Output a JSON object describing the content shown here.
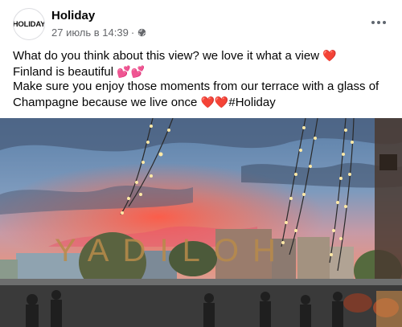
{
  "post": {
    "page_name": "Holiday",
    "avatar_text": "HOLIDAY",
    "date": "27 июль в 14:39",
    "separator": "·",
    "privacy_icon": "globe-icon",
    "more_icon": "more-dots-icon",
    "text_line1": "What do you think about this view? we love it what a view",
    "text_line2": "Finland is beautiful",
    "text_line3": "Make sure you enjoy those moments from our terrace with a glass of",
    "text_line4": "Champagne because we live once",
    "heart": "❤️",
    "hearts_sparkle": "💕💕",
    "hearts_double": "❤️❤️",
    "hashtag": "#Holiday"
  },
  "photo": {
    "window_letters": "YADILOH",
    "colors": {
      "sky_top": "#5a7fa8",
      "sky_mid": "#8aa5c4",
      "sunset": "#f26a52",
      "clouds_dark": "#3d4d66"
    }
  }
}
